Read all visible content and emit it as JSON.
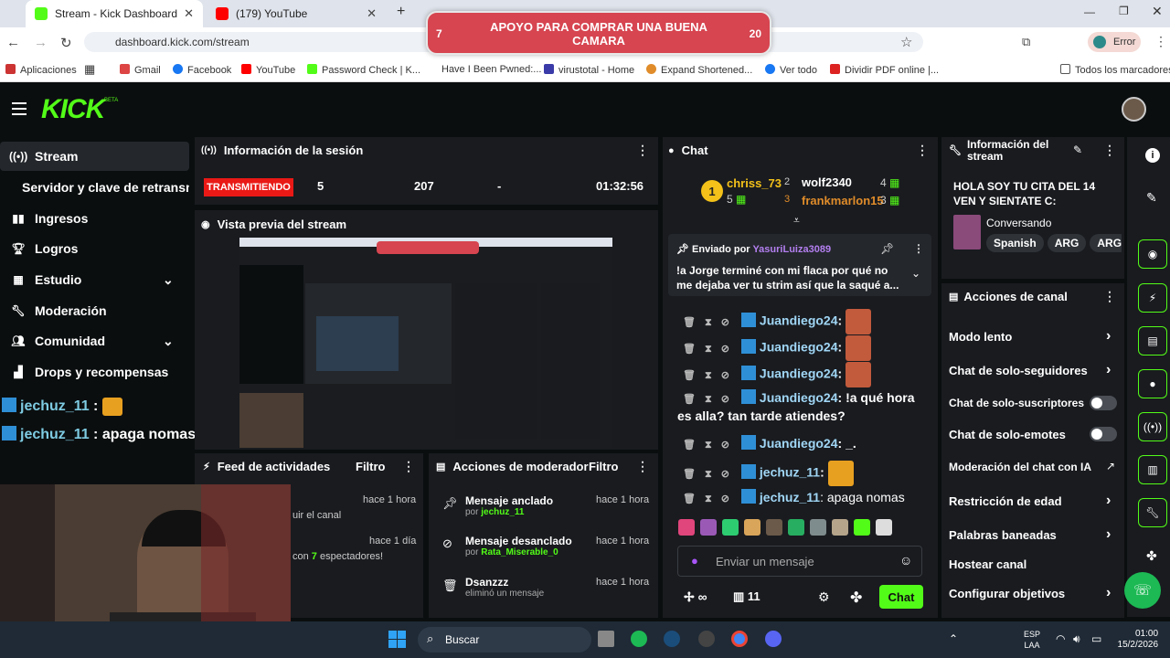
{
  "browser": {
    "tabs": [
      {
        "label": "Stream - Kick Dashboard"
      },
      {
        "label": "(179) YouTube"
      }
    ],
    "url": "dashboard.kick.com/stream",
    "profile": "Error",
    "bookmarks": [
      "Aplicaciones",
      "Gmail",
      "Facebook",
      "YouTube",
      "Password Check | K...",
      "Have I Been Pwned:...",
      "virustotal - Home",
      "Expand Shortened...",
      "Ver todo",
      "Dividir PDF online |...",
      "Todos los marcadores"
    ]
  },
  "goal": {
    "title": "APOYO PARA COMPRAR UNA BUENA CAMARA",
    "current": "7",
    "target": "20"
  },
  "sidebar": {
    "items": [
      {
        "label": "Stream",
        "icon": "broadcast-icon"
      },
      {
        "label": "Servidor y clave de retransm",
        "icon": ""
      },
      {
        "label": "Ingresos",
        "icon": "chart-icon"
      },
      {
        "label": "Logros",
        "icon": "trophy-icon"
      },
      {
        "label": "Estudio",
        "icon": "grid-icon"
      },
      {
        "label": "Moderación",
        "icon": "wrench-icon"
      },
      {
        "label": "Comunidad",
        "icon": "users-icon"
      },
      {
        "label": "Drops y recompensas",
        "icon": "gift-icon"
      }
    ],
    "overlay_chat": [
      {
        "user": "jechuz_11",
        "text": ""
      },
      {
        "user": "jechuz_11",
        "text": "apaga nomas"
      }
    ]
  },
  "session": {
    "title": "Información de la sesión",
    "status": "TRANSMITIENDO",
    "viewers": "5",
    "followers": "207",
    "subs": "-",
    "duration": "01:32:56"
  },
  "preview": {
    "title": "Vista previa del stream"
  },
  "feed": {
    "title": "Feed de actividades",
    "filter": "Filtro",
    "items": [
      {
        "text": "uir el canal",
        "time": "hace 1 hora"
      },
      {
        "text_pre": "con ",
        "count": "7",
        "text_post": " espectadores!",
        "time": "hace 1 día"
      }
    ]
  },
  "modactions": {
    "title": "Acciones de moderador",
    "filter": "Filtro",
    "items": [
      {
        "title": "Mensaje anclado",
        "by": "por ",
        "user": "jechuz_11",
        "time": "hace 1 hora"
      },
      {
        "title": "Mensaje desanclado",
        "by": "por ",
        "user": "Rata_Miserable_0",
        "time": "hace 1 hora"
      },
      {
        "title": "Dsanzzz",
        "by": "eliminó un mensaje",
        "user": "",
        "time": "hace 1 hora"
      }
    ]
  },
  "chat": {
    "title": "Chat",
    "leaderboard": [
      {
        "rank": "1",
        "user": "chriss_73",
        "count": "5"
      },
      {
        "rank": "2",
        "user": "wolf2340",
        "count": "4"
      },
      {
        "rank": "3",
        "user": "frankmarlon15",
        "count": "3"
      }
    ],
    "pinned": {
      "label": "Enviado por ",
      "user": "YasuriLuiza3089",
      "text": "!a Jorge terminé con mi flaca por qué no me dejaba ver tu strim así que la saqué a..."
    },
    "messages": [
      {
        "user": "Juandiego24",
        "text": ":"
      },
      {
        "user": "Juandiego24",
        "text": ":"
      },
      {
        "user": "Juandiego24",
        "text": ":"
      },
      {
        "user": "Juandiego24",
        "text": ": !a qué hora"
      },
      {
        "user": "",
        "text": "es alla? tan tarde atiendes?"
      },
      {
        "user": "Juandiego24",
        "text": ": _."
      },
      {
        "user": "jechuz_11",
        "text": ":"
      },
      {
        "user": "jechuz_11",
        "text": ": apaga nomas"
      }
    ],
    "input_placeholder": "Enviar un mensaje",
    "points": "∞",
    "gifts": "11",
    "send": "Chat"
  },
  "streaminfo": {
    "title": "Información del stream",
    "stream_title": "HOLA SOY TU CITA DEL 14 VEN Y SIENTATE C:",
    "category": "Conversando",
    "tags": [
      "Spanish",
      "ARG",
      "ARG"
    ]
  },
  "channel_actions": {
    "title": "Acciones de canal",
    "items": [
      "Modo lento",
      "Chat de solo-seguidores",
      "Chat de solo-suscriptores",
      "Chat de solo-emotes",
      "Moderación del chat con IA",
      "Restricción de edad",
      "Palabras baneadas",
      "Hostear canal",
      "Configurar objetivos"
    ]
  },
  "taskbar": {
    "search": "Buscar",
    "lang": "ESP",
    "region": "LAA",
    "time": "01:00",
    "date": "15/2/2026"
  },
  "colors": {
    "accent": "#53fc18",
    "live": "#e91916",
    "panel": "#191b1f"
  }
}
